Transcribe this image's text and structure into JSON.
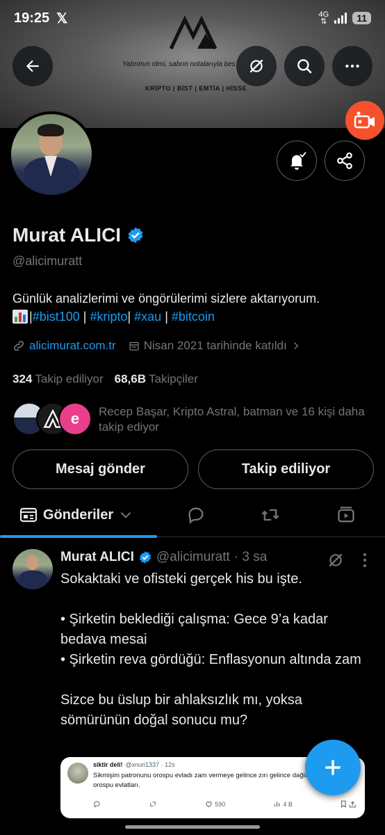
{
  "status_bar": {
    "time": "19:25",
    "network": "4G",
    "battery": "11"
  },
  "banner": {
    "tagline": "Yatırımın ritmi, sabrın notalarıyla bes",
    "categories": "KRİPTO | BİST | EMTİA | HİSSE"
  },
  "profile": {
    "name": "Murat ALICI",
    "handle": "@alicimuratt",
    "bio_line1": "Günlük analizlerimi ve öngörülerimi sizlere aktarıyorum.",
    "bio_tags": [
      "#bist100",
      "#kripto",
      "#xau",
      "#bitcoin"
    ],
    "bio_separators": [
      " | ",
      "| ",
      " | "
    ],
    "website": "alicimurat.com.tr",
    "joined": "Nisan 2021 tarihinde katıldı",
    "following_count": "324",
    "following_label": "Takip ediliyor",
    "followers_count": "68,6B",
    "followers_label": "Takipçiler",
    "followed_by_text": "Recep Başar, Kripto Astral, batman ve 16 kişi daha takip ediyor"
  },
  "actions": {
    "message_label": "Mesaj gönder",
    "following_label": "Takip ediliyor"
  },
  "tabs": {
    "active_label": "Gönderiler"
  },
  "post": {
    "name": "Murat ALICI",
    "handle": "@alicimuratt",
    "time": "· 3 sa",
    "body": "Sokaktaki ve ofisteki gerçek his bu işte.\n\n• Şirketin beklediği çalışma: Gece 9’a kadar bedava mesai\n• Şirketin reva gördüğü: Enflasyonun altında zam\n\nSizce bu üslup bir ahlaksızlık mı, yoksa sömürünün doğal sonucu mu?"
  },
  "quote": {
    "name": "siktir deli!",
    "handle": "@xnuri1337 · 12s",
    "text": "Sikmişim patronunu orospu evladı zam vermeye gelince zırı gelince dağları bekliyor orospu evlatları.",
    "likes": "590",
    "views": "4 B"
  },
  "colors": {
    "accent": "#1d9bf0",
    "background": "#000000",
    "muted": "#71767b",
    "live": "#f4512c"
  }
}
